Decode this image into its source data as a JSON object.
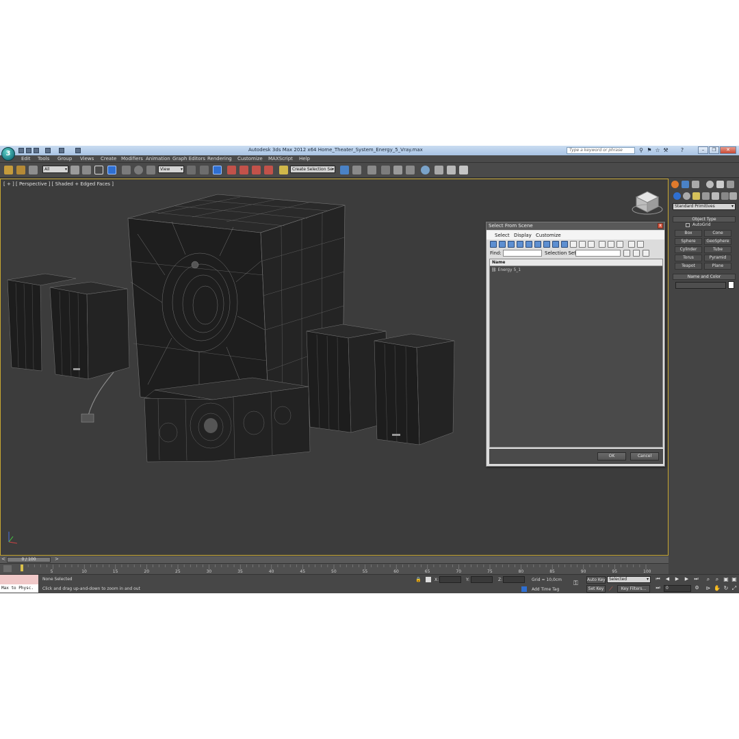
{
  "app": {
    "title": "Autodesk 3ds Max  2012 x64      Home_Theater_System_Energy_5_Vray.max",
    "search_placeholder": "Type a keyword or phrase",
    "logo_text": "3"
  },
  "menu": [
    "Edit",
    "Tools",
    "Group",
    "Views",
    "Create",
    "Modifiers",
    "Animation",
    "Graph Editors",
    "Rendering",
    "Customize",
    "MAXScript",
    "Help"
  ],
  "toolbar": {
    "selection_filter": "All",
    "reference_coord": "View",
    "named_selection_placeholder": "Create Selection Se"
  },
  "viewport": {
    "label": "[ + ] [ Perspective ] [ Shaded + Edged Faces ]"
  },
  "dialog": {
    "title": "Select From Scene",
    "close": "x",
    "menu": [
      "Select",
      "Display",
      "Customize"
    ],
    "find_label": "Find:",
    "selection_set_label": "Selection Set:",
    "column_name": "Name",
    "objects": [
      "Energy 5_1"
    ],
    "ok": "OK",
    "cancel": "Cancel"
  },
  "command_panel": {
    "category": "Standard Primitives",
    "object_type_title": "Object Type",
    "autogrid": "AutoGrid",
    "primitives": [
      "Box",
      "Cone",
      "Sphere",
      "GeoSphere",
      "Cylinder",
      "Tube",
      "Torus",
      "Pyramid",
      "Teapot",
      "Plane"
    ],
    "name_color_title": "Name and Color"
  },
  "timeline": {
    "current": "0 / 100",
    "ticks": [
      "0",
      "5",
      "10",
      "15",
      "20",
      "25",
      "30",
      "35",
      "40",
      "45",
      "50",
      "55",
      "60",
      "65",
      "70",
      "75",
      "80",
      "85",
      "90",
      "95",
      "100"
    ]
  },
  "status": {
    "maxscript_output": "Max to Physc.",
    "selection": "None Selected",
    "prompt": "Click and drag up-and-down to zoom in and out",
    "x_label": "X:",
    "y_label": "Y:",
    "z_label": "Z:",
    "grid": "Grid = 10,0cm",
    "add_time_tag": "Add Time Tag",
    "auto_key": "Auto Key",
    "set_key": "Set Key",
    "key_mode": "Selected",
    "key_filters": "Key Filters...",
    "frame": "0"
  },
  "colors": {
    "viewport_border": "#c9a832",
    "toolbar_bg": "#4a4a4a",
    "accent_blue": "#2f6fd1"
  }
}
